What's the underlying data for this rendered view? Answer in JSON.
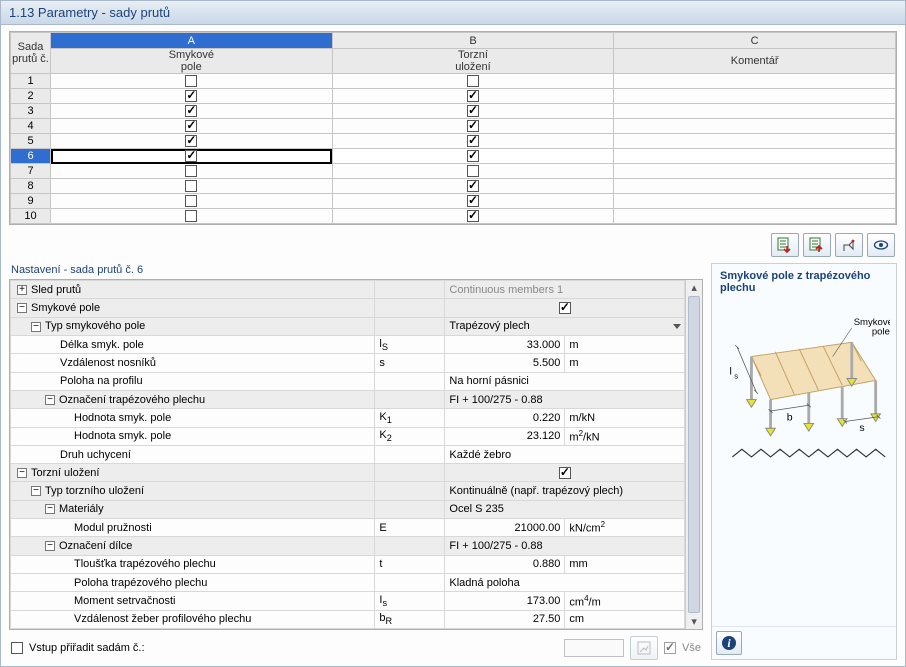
{
  "title": "1.13 Parametry - sady prutů",
  "grid": {
    "col_letters": [
      "A",
      "B",
      "C"
    ],
    "header_rowcol": "Sada prutů č.",
    "header_a": "Smykové pole",
    "header_b": "Torzní uložení",
    "header_c": "Komentář",
    "rows": [
      {
        "n": "1",
        "a": false,
        "b": false,
        "c": ""
      },
      {
        "n": "2",
        "a": true,
        "b": true,
        "c": ""
      },
      {
        "n": "3",
        "a": true,
        "b": true,
        "c": ""
      },
      {
        "n": "4",
        "a": true,
        "b": true,
        "c": ""
      },
      {
        "n": "5",
        "a": true,
        "b": true,
        "c": ""
      },
      {
        "n": "6",
        "a": true,
        "b": true,
        "c": "",
        "selected": true
      },
      {
        "n": "7",
        "a": false,
        "b": false,
        "c": ""
      },
      {
        "n": "8",
        "a": false,
        "b": true,
        "c": ""
      },
      {
        "n": "9",
        "a": false,
        "b": true,
        "c": ""
      },
      {
        "n": "10",
        "a": false,
        "b": true,
        "c": ""
      }
    ]
  },
  "settings_title": "Nastavení - sada prutů č. 6",
  "props": [
    {
      "class": "hdr",
      "toggle": "+",
      "indent": 0,
      "name": "Sled prutů",
      "sym": "",
      "val": "Continuous members 1",
      "valspan": 2,
      "valClass": "gray-text"
    },
    {
      "class": "hdr",
      "toggle": "-",
      "indent": 0,
      "name": "Smykové pole",
      "sym": "",
      "chk": true,
      "valspan": 2
    },
    {
      "class": "hdr",
      "toggle": "-",
      "indent": 1,
      "name": "Typ smykového pole",
      "sym": "",
      "val": "Trapézový plech",
      "valspan": 2,
      "drop": true
    },
    {
      "indent": 2,
      "name": "Délka smyk. pole",
      "sym": "l<sub>S</sub>",
      "val": "33.000",
      "unit": "m"
    },
    {
      "indent": 2,
      "name": "Vzdálenost nosníků",
      "sym": "s",
      "val": "5.500",
      "unit": "m"
    },
    {
      "indent": 2,
      "name": "Poloha na profilu",
      "sym": "",
      "val": "Na horní pásnici",
      "valspan": 2
    },
    {
      "class": "hdr",
      "toggle": "-",
      "indent": 2,
      "name": "Označení trapézového plechu",
      "sym": "",
      "val": "FI + 100/275 - 0.88",
      "valspan": 2
    },
    {
      "indent": 3,
      "name": "Hodnota smyk. pole",
      "sym": "K<sub>1</sub>",
      "val": "0.220",
      "unit": "m/kN"
    },
    {
      "indent": 3,
      "name": "Hodnota smyk. pole",
      "sym": "K<sub>2</sub>",
      "val": "23.120",
      "unit_html": "m<span class='sup'>2</span>/kN"
    },
    {
      "indent": 2,
      "name": "Druh uchycení",
      "sym": "",
      "val": "Každé žebro",
      "valspan": 2
    },
    {
      "class": "hdr",
      "toggle": "-",
      "indent": 0,
      "name": "Torzní uložení",
      "sym": "",
      "chk": true,
      "valspan": 2
    },
    {
      "class": "hdr",
      "toggle": "-",
      "indent": 1,
      "name": "Typ torzního uložení",
      "sym": "",
      "val": "Kontinuálně (např. trapézový plech)",
      "valspan": 2
    },
    {
      "class": "hdr",
      "toggle": "-",
      "indent": 2,
      "name": "Materiály",
      "sym": "",
      "val": "Ocel S 235",
      "valspan": 2
    },
    {
      "indent": 3,
      "name": "Modul pružnosti",
      "sym": "E",
      "val": "21000.00",
      "unit_html": "kN/cm<span class='sup'>2</span>"
    },
    {
      "class": "hdr",
      "toggle": "-",
      "indent": 2,
      "name": "Označení dílce",
      "sym": "",
      "val": "FI + 100/275 - 0.88",
      "valspan": 2
    },
    {
      "indent": 3,
      "name": "Tloušťka trapézového plechu",
      "sym": "t",
      "val": "0.880",
      "unit": "mm"
    },
    {
      "indent": 3,
      "name": "Poloha trapézového plechu",
      "sym": "",
      "val": "Kladná poloha",
      "valspan": 2
    },
    {
      "indent": 3,
      "name": "Moment setrvačnosti",
      "sym": "I<sub>s</sub>",
      "val": "173.00",
      "unit_html": "cm<span class='sup'>4</span>/m"
    },
    {
      "indent": 3,
      "name": "Vzdálenost žeber profilového plechu",
      "sym": "b<sub>R</sub>",
      "val": "27.50",
      "unit": "cm"
    }
  ],
  "assign": {
    "checkbox_label": "Vstup přiřadit sadám č.:",
    "all_label": "Vše"
  },
  "right": {
    "heading": "Smykové pole z trapézového plechu",
    "label_smyk": "Smykové pole",
    "label_ls": "l",
    "label_ls_sub": "s",
    "label_b": "b",
    "label_s": "s"
  },
  "chart_data": null
}
